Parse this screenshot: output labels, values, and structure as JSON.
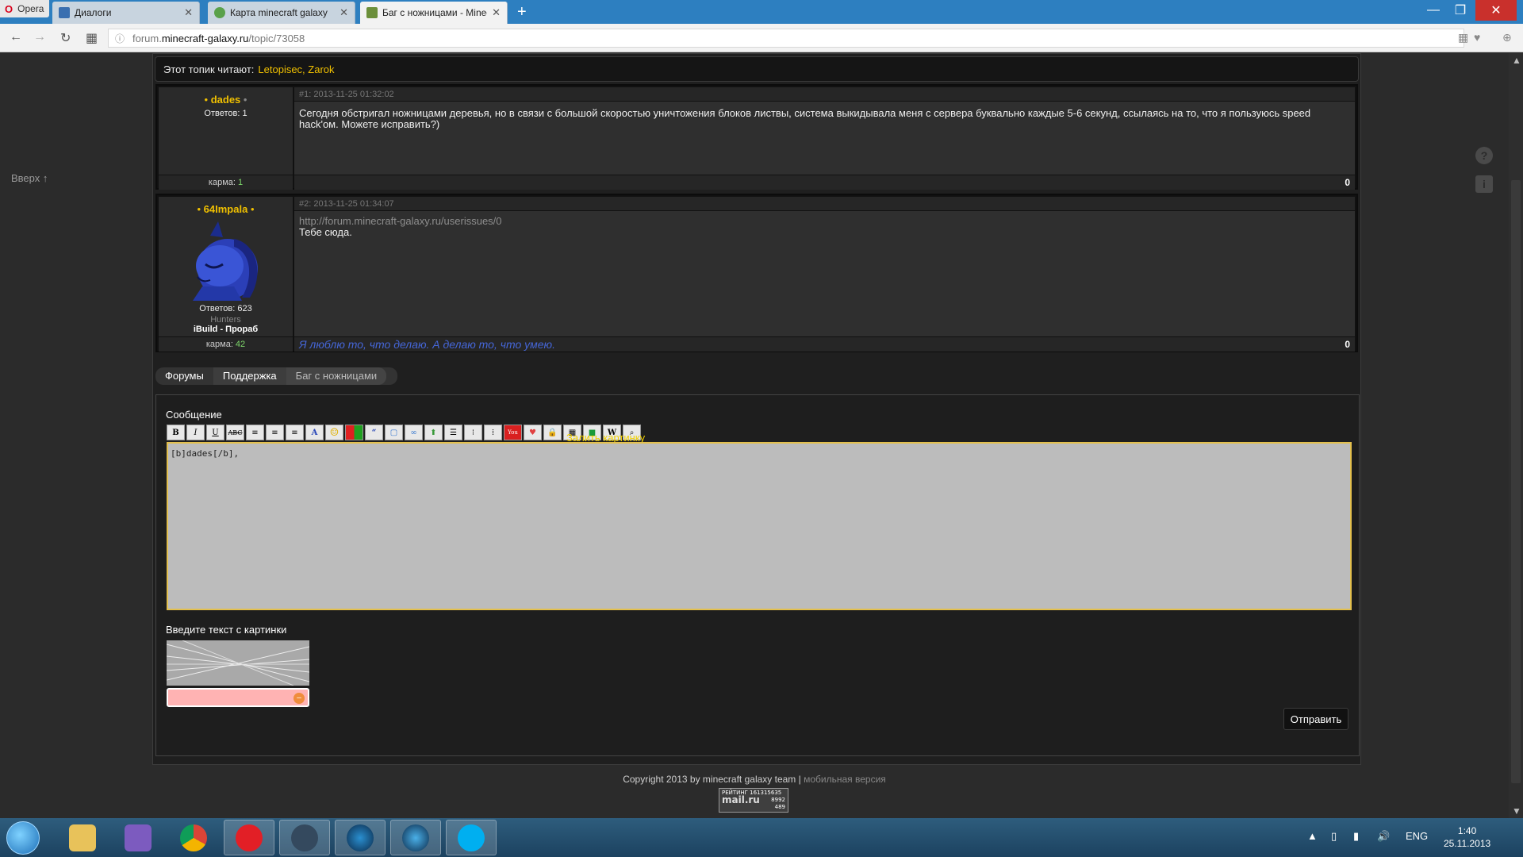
{
  "browser": {
    "opera_label": "Opera",
    "tabs": [
      {
        "title": "Диалоги"
      },
      {
        "title": "Карта minecraft galaxy"
      },
      {
        "title": "Баг с ножницами - Minec"
      }
    ],
    "url_prefix": "forum.",
    "url_domain": "minecraft-galaxy.ru",
    "url_path": "/topic/73058"
  },
  "page": {
    "up_link": "Вверх ↑",
    "reading_label": "Этот топик читают:",
    "readers": "Letopisec, Zarok",
    "posts": [
      {
        "username": "dades",
        "replies": "Ответов: 1",
        "meta": "#1: 2013-11-25 01:32:02",
        "text": "Сегодня обстригал ножницами деревья, но в связи с большой скоростью уничтожения блоков листвы, система выкидывала меня с сервера буквально каждые 5-6 секунд, ссылаясь на то, что я пользуюсь speed hack'ом. Можете исправить?)",
        "karma_label": "карма:",
        "karma_value": "1",
        "score": "0"
      },
      {
        "username": "64Impala",
        "replies": "Ответов: 623",
        "group": "Hunters",
        "title": "iBuild - Прораб",
        "meta": "#2: 2013-11-25 01:34:07",
        "link": "http://forum.minecraft-galaxy.ru/userissues/0",
        "text": "Тебе сюда.",
        "karma_label": "карма:",
        "karma_value": "42",
        "signature": "Я люблю то, что делаю. А делаю то, что умею.",
        "score": "0"
      }
    ],
    "breadcrumb": [
      "Форумы",
      "Поддержка",
      "Баг с ножницами"
    ],
    "reply": {
      "title": "Сообщение",
      "upload_link": "Залить картинку",
      "message": "[b]dades[/b], ",
      "captcha_label": "Введите текст с картинки",
      "send_button": "Отправить"
    },
    "footer": {
      "copyright": "Copyright 2013 by minecraft galaxy team",
      "separator": "|",
      "mobile": "мобильная версия"
    },
    "counter": {
      "line1": "РЕЙТИНГ 161315635",
      "brand": "mail.ru",
      "num1": "8992",
      "num2": "489"
    }
  },
  "taskbar": {
    "lang": "ENG",
    "time": "1:40",
    "date": "25.11.2013"
  },
  "colors": {
    "accent_yellow": "#f0c000",
    "signature_blue": "#4566d8",
    "karma_green": "#7ed86b"
  }
}
